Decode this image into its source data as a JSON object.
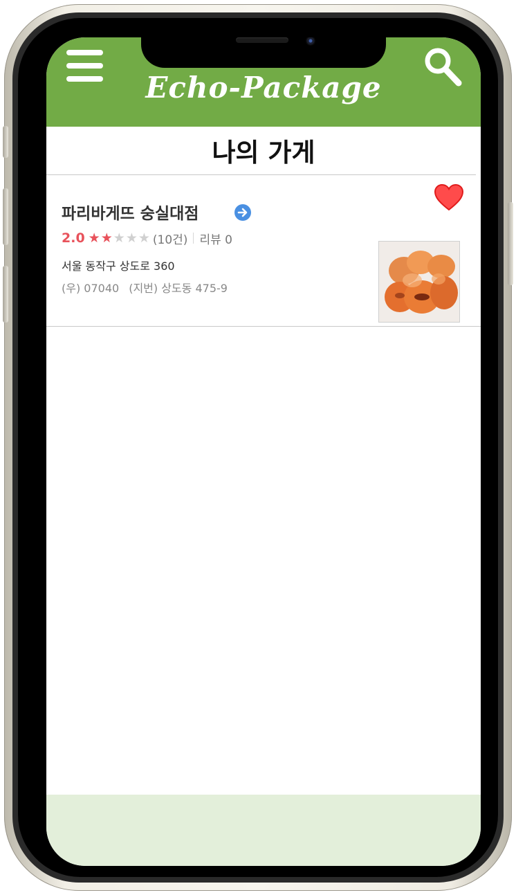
{
  "header": {
    "app_title": "Echo-Package",
    "bg_color": "#72ab46",
    "menu_icon": "hamburger-menu-icon",
    "search_icon": "search-icon"
  },
  "page": {
    "title": "나의 가게"
  },
  "store": {
    "name": "파리바게뜨 숭실대점",
    "rating": "2.0",
    "stars_filled": 2,
    "stars_total": 5,
    "rating_count": "(10건)",
    "review_label": "리뷰 0",
    "address": "서울 동작구 상도로 360",
    "postal": "(우) 07040",
    "lot_address": "(지번) 상도동 475-9",
    "favorite": true,
    "accent_color": "#e8525b"
  }
}
